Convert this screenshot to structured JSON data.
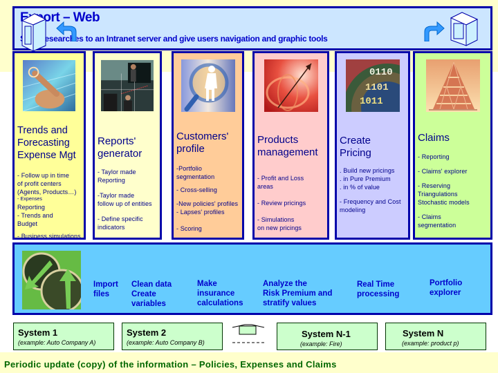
{
  "header": {
    "title": "Export – Web",
    "subtitle": "Send researches to an Intranet server and give users navigation and graphic tools",
    "icons": [
      "server-left-icon",
      "arrow-back-icon",
      "arrow-forward-icon",
      "server-right-icon"
    ]
  },
  "columns": [
    {
      "title": "Trends and Forecasting Expense Mgt",
      "title_lines": [
        "Trends and",
        "Forecasting",
        "Expense Mgt"
      ],
      "image": "hand-pointing-screen-image",
      "bg": "#ffff99",
      "items": [
        "- Follow up in time",
        "of profit centers",
        "(Agents, Products…)",
        "- Expenses",
        "Reporting",
        "- Trends and",
        "Budget",
        "",
        "- Business simulations"
      ]
    },
    {
      "title": "Reports' generator",
      "title_lines": [
        "Reports'",
        "generator"
      ],
      "image": "presentation-meeting-image",
      "bg": "#ffffcc",
      "items": [
        "- Taylor made",
        "Reporting",
        "",
        "-Taylor made",
        "follow up of entities",
        "",
        "- Define specific",
        "indicators"
      ]
    },
    {
      "title": "Customers' profile",
      "title_lines": [
        "Customers'",
        "profile"
      ],
      "image": "magnifier-person-image",
      "bg": "#ffcc99",
      "items": [
        "-Portfolio",
        "segmentation",
        "",
        "- Cross-selling",
        "",
        "-New policies' profiles",
        "- Lapses' profiles",
        "",
        "- Scoring"
      ]
    },
    {
      "title": "Products management",
      "title_lines": [
        "Products",
        "management"
      ],
      "image": "globe-arrow-image",
      "bg": "#ffcccc",
      "items": [
        "- Profit and Loss",
        "areas",
        "",
        "- Review pricings",
        "",
        "- Simulations",
        "on new pricings"
      ]
    },
    {
      "title": "Create Pricing",
      "title_lines": [
        "Create",
        "Pricing"
      ],
      "image": "binary-sphere-image",
      "bg": "#ccccff",
      "items": [
        ". Build new pricings",
        ". in Pure Premium",
        ". in % of value",
        "",
        "- Frequency and Cost",
        "modeling"
      ]
    },
    {
      "title": "Claims",
      "title_lines": [
        "Claims"
      ],
      "image": "house-of-cards-image",
      "bg": "#ccff99",
      "items": [
        "- Reporting",
        "",
        "- Claims' explorer",
        "",
        "- Reserving",
        "Triangulations",
        "Stochastic models",
        "",
        "- Claims",
        "segmentation"
      ]
    }
  ],
  "process": {
    "image": "compass-arrows-image",
    "steps": [
      {
        "lines": [
          "Import",
          "files"
        ]
      },
      {
        "lines": [
          "Clean data",
          "Create",
          "variables"
        ]
      },
      {
        "lines": [
          "Make",
          "insurance",
          "calculations"
        ]
      },
      {
        "lines": [
          "Analyze the",
          "Risk Premium and",
          "stratify values"
        ]
      },
      {
        "lines": [
          "Real Time",
          "processing"
        ]
      },
      {
        "lines": [
          "Portfolio",
          "explorer"
        ]
      }
    ]
  },
  "systems": [
    {
      "title": "System 1",
      "example": "(example: Auto Company A)"
    },
    {
      "title": "System 2",
      "example": "(example: Auto Company B)"
    },
    {
      "title": "System N-1",
      "example": "(example: Fire)"
    },
    {
      "title": "System N",
      "example": "(example: product p)"
    }
  ],
  "footer": {
    "text": "Periodic update (copy) of the information – Policies, Expenses and Claims"
  }
}
